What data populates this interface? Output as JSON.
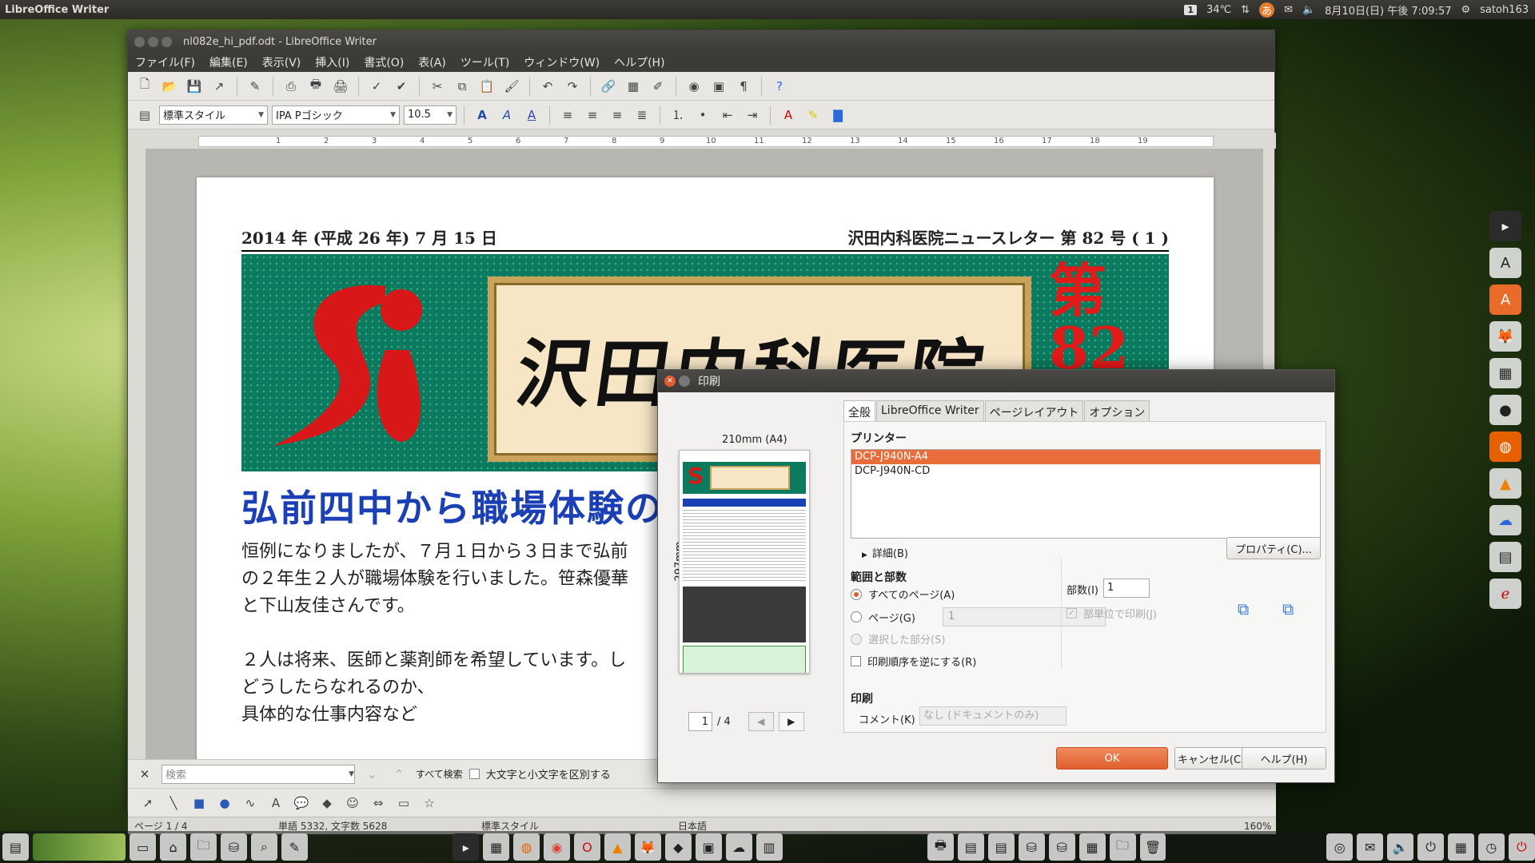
{
  "panel": {
    "app": "LibreOffice Writer",
    "workspace": "1",
    "temp": "34℃",
    "ime": "あ",
    "datetime": "8月10日(日) 午後 7:09:57",
    "user": "satoh163"
  },
  "writer": {
    "title": "nl082e_hi_pdf.odt - LibreOffice Writer",
    "menu": [
      "ファイル(F)",
      "編集(E)",
      "表示(V)",
      "挿入(I)",
      "書式(O)",
      "表(A)",
      "ツール(T)",
      "ウィンドウ(W)",
      "ヘルプ(H)"
    ],
    "style": "標準スタイル",
    "font": "IPA Pゴシック",
    "size": "10.5",
    "ruler": [
      "1",
      "2",
      "3",
      "4",
      "5",
      "6",
      "7",
      "8",
      "9",
      "10",
      "11",
      "12",
      "13",
      "14",
      "15",
      "16",
      "17",
      "18",
      "19"
    ]
  },
  "document": {
    "date": "2014 年 (平成 26 年) 7 月 15 日",
    "issue": "沢田内科医院ニュースレター 第 82 号 ( 1 )",
    "banner_title": "沢田内科医院",
    "banner_no": "第",
    "banner_no2": "82",
    "headline": "弘前四中から職場体験の",
    "p1": [
      "恒例になりましたが、７月１日から３日まで弘前",
      "の２年生２人が職場体験を行いました。笹森優華",
      "と下山友佳さんです。"
    ],
    "p2": [
      "２人は将来、医師と薬剤師を希望しています。し",
      "どうしたらなれるのか、",
      "具体的な仕事内容など"
    ]
  },
  "findbar": {
    "placeholder": "検索",
    "search_all": "すべて検索",
    "match_case": "大文字と小文字を区別する"
  },
  "status": {
    "page": "ページ 1 / 4",
    "words": "単語 5332, 文字数 5628",
    "style": "標準スタイル",
    "lang": "日本語",
    "zoom": "160%"
  },
  "print": {
    "title": "印刷",
    "preview_w": "210mm (A4)",
    "preview_h": "297mm",
    "page_cur": "1",
    "page_total": "/ 4",
    "tabs": [
      "全般",
      "LibreOffice Writer",
      "ページレイアウト",
      "オプション"
    ],
    "printer_label": "プリンター",
    "printers": [
      "DCP-J940N-A4",
      "DCP-J940N-CD"
    ],
    "details": "詳細(B)",
    "properties": "プロパティ(C)...",
    "range_label": "範囲と部数",
    "all_pages": "すべてのページ(A)",
    "pages": "ページ(G)",
    "pages_value": "1",
    "selection": "選択した部分(S)",
    "reverse": "印刷順序を逆にする(R)",
    "copies_label": "部数(I)",
    "copies": "1",
    "collate": "部単位で印刷(J)",
    "print_label": "印刷",
    "comment_label": "コメント(K)",
    "comment_value": "なし (ドキュメントのみ)",
    "ok": "OK",
    "cancel": "キャンセル(C)",
    "help": "ヘルプ(H)"
  }
}
